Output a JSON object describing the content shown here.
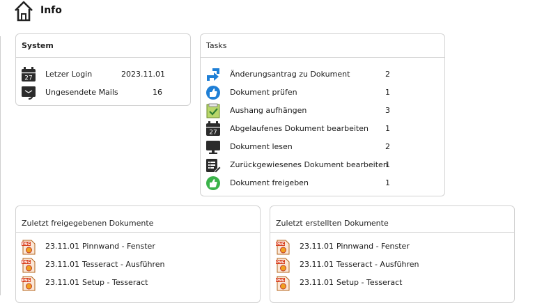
{
  "header": {
    "title": "Info"
  },
  "system": {
    "title": "System",
    "items": [
      {
        "label": "Letzer Login",
        "value": "2023.11.01",
        "icon": "calendar-icon"
      },
      {
        "label": "Ungesendete Mails",
        "value": "16",
        "icon": "mail-send-icon"
      }
    ]
  },
  "tasks": {
    "title": "Tasks",
    "items": [
      {
        "label": "Änderungsantrag zu Dokument",
        "count": "2",
        "icon": "change-request-icon"
      },
      {
        "label": "Dokument prüfen",
        "count": "1",
        "icon": "thumbs-up-icon"
      },
      {
        "label": "Aushang aufhängen",
        "count": "3",
        "icon": "notice-board-icon"
      },
      {
        "label": "Abgelaufenes Dokument bearbeiten",
        "count": "1",
        "icon": "calendar-icon"
      },
      {
        "label": "Dokument lesen",
        "count": "2",
        "icon": "monitor-icon"
      },
      {
        "label": "Zurückgewiesenes Dokument bearbeiten",
        "count": "1",
        "icon": "edit-list-icon"
      },
      {
        "label": "Dokument freigeben",
        "count": "1",
        "icon": "approve-icon"
      }
    ]
  },
  "released": {
    "title": "Zuletzt freigegebenen Dokumente",
    "items": [
      {
        "date": "23.11.01",
        "name": "Pinnwand - Fenster",
        "icon": "png-file-icon"
      },
      {
        "date": "23.11.01",
        "name": "Tesseract - Ausführen",
        "icon": "png-file-icon"
      },
      {
        "date": "23.11.01",
        "name": "Setup - Tesseract",
        "icon": "png-file-icon"
      }
    ]
  },
  "created": {
    "title": "Zuletzt erstellten Dokumente",
    "items": [
      {
        "date": "23.11.01",
        "name": "Pinnwand - Fenster",
        "icon": "png-file-icon"
      },
      {
        "date": "23.11.01",
        "name": "Tesseract - Ausführen",
        "icon": "png-file-icon"
      },
      {
        "date": "23.11.01",
        "name": "Setup - Tesseract",
        "icon": "png-file-icon"
      }
    ]
  },
  "colors": {
    "border": "#d2d2d2",
    "accent_blue": "#1f7fd6",
    "accent_green": "#3bb34a"
  }
}
